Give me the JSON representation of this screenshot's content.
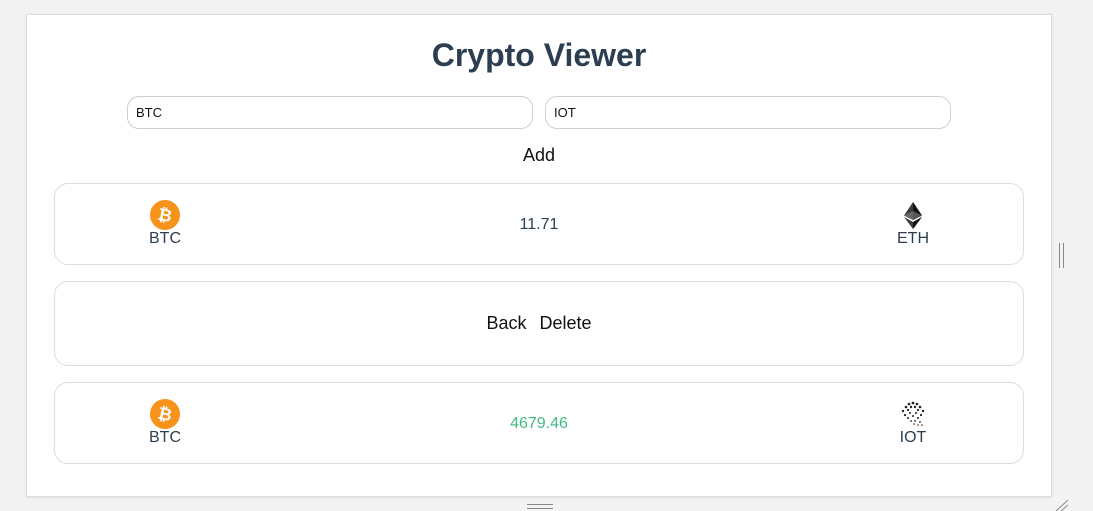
{
  "app": {
    "title": "Crypto Viewer"
  },
  "form": {
    "from_value": "BTC",
    "to_value": "IOT",
    "add_label": "Add"
  },
  "pairs": [
    {
      "from": {
        "symbol": "BTC",
        "icon": "bitcoin-icon"
      },
      "to": {
        "symbol": "ETH",
        "icon": "ethereum-icon"
      },
      "rate": "11.71",
      "rate_color": "#2c3e50"
    },
    {
      "from": {
        "symbol": "BTC",
        "icon": "bitcoin-icon"
      },
      "to": {
        "symbol": "IOT",
        "icon": "iota-icon"
      },
      "rate": "4679.46",
      "rate_color": "#42b983"
    }
  ],
  "actions": {
    "back_label": "Back",
    "delete_label": "Delete"
  },
  "colors": {
    "bitcoin": "#f7931a",
    "title": "#2c3e50",
    "accent_green": "#42b983"
  }
}
